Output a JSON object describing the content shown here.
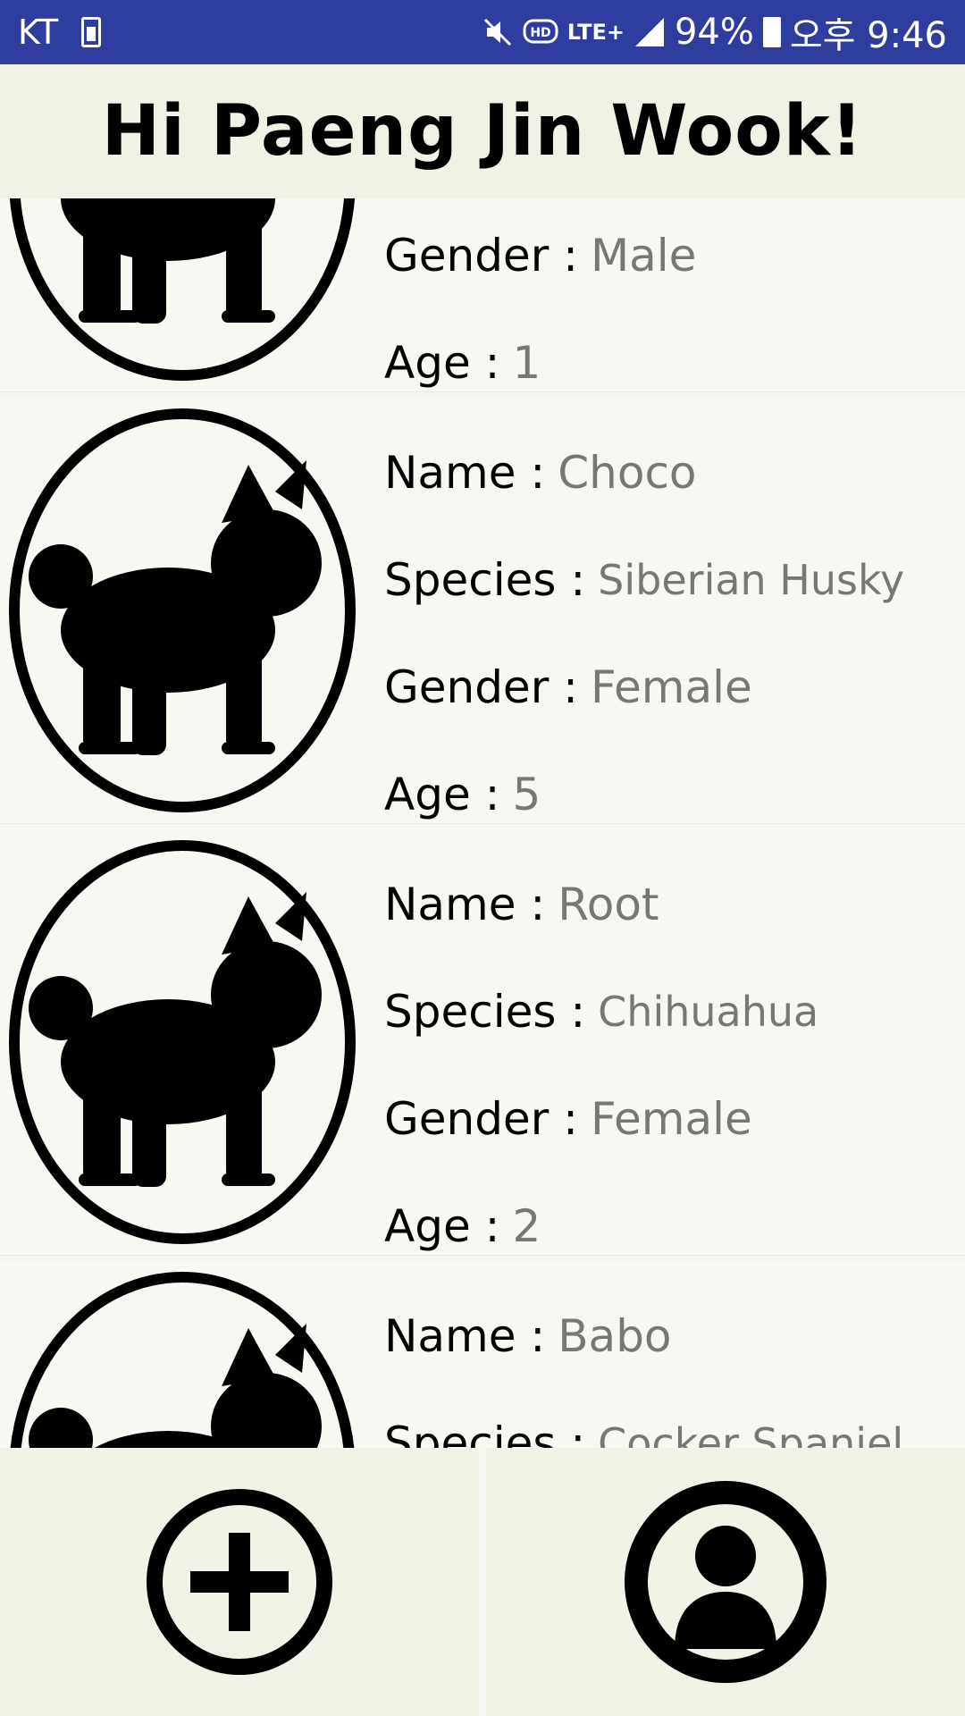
{
  "status_bar": {
    "carrier": "KT",
    "network": "LTE+",
    "battery": "94%",
    "time": "오후 9:46",
    "icons": [
      "sim-card-icon",
      "mute-icon",
      "hd-voice-icon",
      "lte-icon",
      "signal-icon",
      "battery-icon"
    ]
  },
  "header": {
    "title": "Hi Paeng Jin Wook!"
  },
  "labels": {
    "name": "Name :",
    "species": "Species :",
    "gender": "Gender :",
    "age": "Age :"
  },
  "pets": [
    {
      "name": "",
      "species": "",
      "gender": "Male",
      "age": "1"
    },
    {
      "name": "Choco",
      "species": "Siberian Husky",
      "gender": "Female",
      "age": "5"
    },
    {
      "name": "Root",
      "species": "Chihuahua",
      "gender": "Female",
      "age": "2"
    },
    {
      "name": "Babo",
      "species": "Cocker Spaniel",
      "gender": "",
      "age": ""
    }
  ],
  "bottom_nav": {
    "add_icon": "add-circle-icon",
    "profile_icon": "account-circle-icon"
  },
  "colors": {
    "status_bar": "#2f3e9e",
    "header_bg": "#f1f1e6",
    "value_text": "#777777"
  }
}
